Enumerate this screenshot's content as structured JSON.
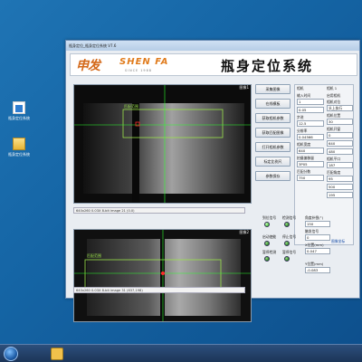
{
  "desktop": {
    "icons": [
      {
        "label": "瓶身定位系统"
      },
      {
        "label": "瓶身定位系统"
      }
    ]
  },
  "window": {
    "title": "瓶身定位_瓶身定位系统 V7.6",
    "logo": {
      "cn": "申发",
      "en": "SHEN FA",
      "sub": "SINCE 1988"
    },
    "app_title": "瓶身定位系统",
    "camera_panels": [
      {
        "caption": "图像1",
        "roi_label": "匹配范围",
        "status": "640x260 0.03X 8-bit image 21   (0.0)"
      },
      {
        "caption": "图像2",
        "roi_label": "匹配范围",
        "status": "640x260 0.03X 8-bit image 31   (637,198)"
      }
    ],
    "buttons": [
      "采集图像",
      "在线模板",
      "获取相机参数",
      "获取匹配图像",
      "打开相机参数",
      "标定比例尺",
      "参数保存"
    ],
    "form": {
      "left_header": "相机",
      "right_header": "相机 1",
      "rows": [
        {
          "label": "输入时间",
          "value": "1"
        },
        {
          "label": "",
          "value": "0.05"
        },
        {
          "label": "步进",
          "value": "12.5"
        },
        {
          "label": "分辨率",
          "value": "0.04566"
        },
        {
          "label": "相机宽度",
          "value": "640"
        },
        {
          "label": "拍摄偏移量",
          "value": "3P05"
        },
        {
          "label": "匹配分数",
          "value": "750"
        }
      ],
      "right_rows": [
        {
          "label": "启用相机",
          "value": ""
        },
        {
          "label": "相机对位",
          "value": "头上执行"
        },
        {
          "label": "相机位置",
          "value": "30"
        },
        {
          "label": "相机开窗",
          "value": "0"
        },
        {
          "label": "",
          "value": "640"
        },
        {
          "label": "",
          "value": "480"
        },
        {
          "label": "相机平口",
          "value": "187"
        },
        {
          "label": "匹配角度",
          "value": "95"
        },
        {
          "label": "",
          "value": "500"
        },
        {
          "label": "",
          "value": "195"
        }
      ],
      "bottom_link": "图像坐标"
    },
    "status_lamps": [
      {
        "label": "到位信号"
      },
      {
        "label": "检测信号"
      },
      {
        "label": "启动使能"
      },
      {
        "label": "停止信号"
      },
      {
        "label": "暂停检测"
      },
      {
        "label": "暂停信号"
      }
    ],
    "readouts": [
      {
        "label": "角度补偿(°)",
        "value": "150"
      },
      {
        "label": "触发信号",
        "value": "0"
      },
      {
        "label": "X位置(mm)",
        "value": "0.047"
      },
      {
        "label": "Y位置(mm)",
        "value": "-0.083"
      }
    ]
  },
  "colors": {
    "desktop": "#1565a5",
    "roi": "#9be34a",
    "crosshair": "#2cff2c",
    "marker": "#ff2b2b",
    "logo": "#e07b1c"
  }
}
